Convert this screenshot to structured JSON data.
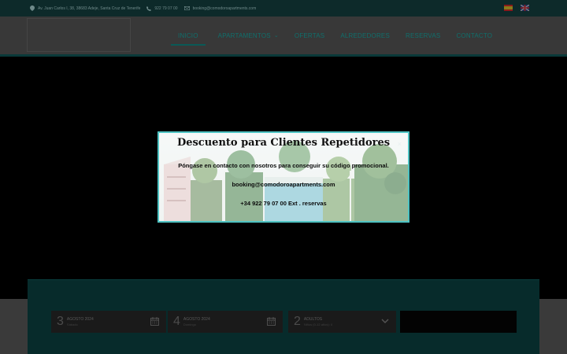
{
  "topbar": {
    "address": "Av. Juan Carlos I, 38, 38683 Adeje, Santa Cruz de Tenerife",
    "phone": "922 79 07 00",
    "email": "booking@comodoroapartments.com"
  },
  "nav": {
    "items": [
      {
        "label": "INICIO"
      },
      {
        "label": "APARTAMENTOS"
      },
      {
        "label": "OFERTAS"
      },
      {
        "label": "ALREDEDORES"
      },
      {
        "label": "RESERVAS"
      },
      {
        "label": "CONTACTO"
      }
    ]
  },
  "modal": {
    "title": "Descuento para Clientes Repetidores",
    "line1": "Póngase en contacto con nosotros para conseguir su código promocional.",
    "email": "booking@comodoroapartments.com",
    "phone": "+34 922 79 07 00 Ext . reservas",
    "close": "×"
  },
  "booking": {
    "checkin": {
      "day": "3",
      "month": "AGOSTO 2024",
      "weekday": "Sábado"
    },
    "checkout": {
      "day": "4",
      "month": "AGOSTO 2024",
      "weekday": "Domingo"
    },
    "guests": {
      "count": "2",
      "label": "ADULTOS",
      "sub": "Niños (0-12 años): 0"
    }
  },
  "colors": {
    "accent": "#0f6f6c",
    "modal_border": "#4ec3c3"
  }
}
